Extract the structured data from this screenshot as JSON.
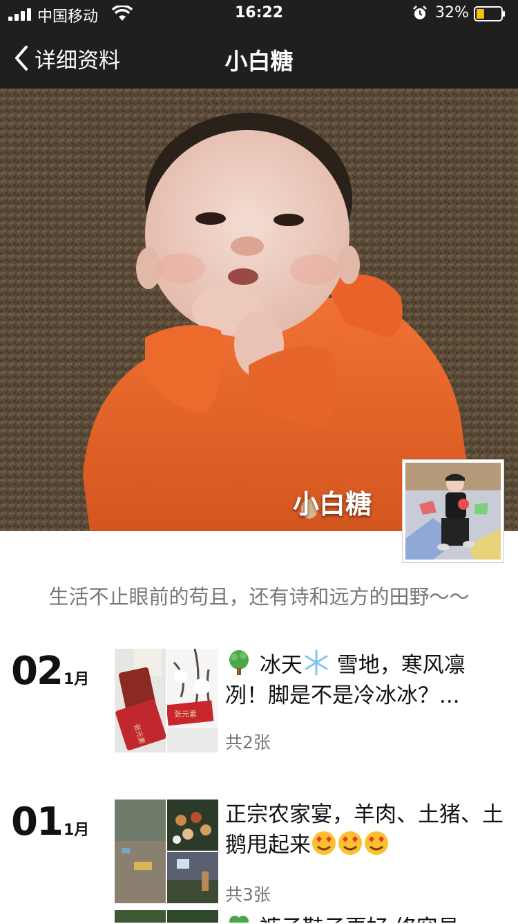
{
  "status_bar": {
    "carrier": "中国移动",
    "time": "16:22",
    "battery": "32%",
    "battery_level": 0.32
  },
  "nav": {
    "back_label": "详细资料",
    "title": "小白糖"
  },
  "profile": {
    "name": "小白糖",
    "signature": "生活不止眼前的苟且，还有诗和远方的田野～～"
  },
  "posts": [
    {
      "day": "02",
      "month": "1月",
      "text_before": "冰天",
      "text_after": "雪地，寒风凛冽！脚是不是冷冰冰？...",
      "count": "共2张"
    },
    {
      "day": "01",
      "month": "1月",
      "text": "正宗农家宴，羊肉、土猪、土鹅甩起来",
      "count": "共3张"
    },
    {
      "text_peek": "裤子鞋子更好 修容易"
    }
  ],
  "colors": {
    "nav_bg": "#1f1f1f",
    "battery_fill": "#f5c400",
    "shirt_orange": "#e5652a"
  }
}
